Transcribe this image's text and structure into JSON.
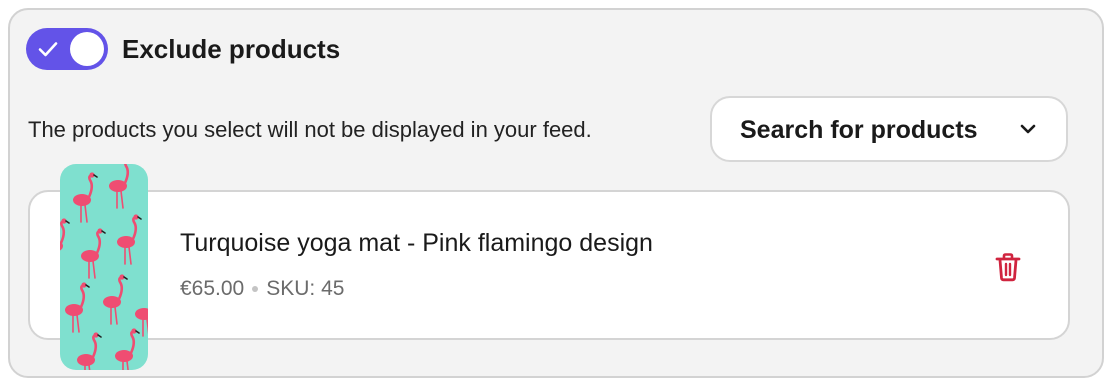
{
  "header": {
    "toggle_state": "on",
    "title": "Exclude products"
  },
  "body": {
    "description": "The products you select will not be displayed in your feed.",
    "search_button_label": "Search for products"
  },
  "product": {
    "name": "Turquoise yoga mat - Pink flamingo design",
    "price": "€65.00",
    "sku": "SKU: 45",
    "thumbnail_icon": "flamingo-pattern-image",
    "remove_icon": "trash-icon"
  },
  "colors": {
    "accent": "#6353e8",
    "danger": "#d0243f",
    "thumbnail_bg": "#7fe0cf",
    "flamingo": "#ef4d72"
  }
}
